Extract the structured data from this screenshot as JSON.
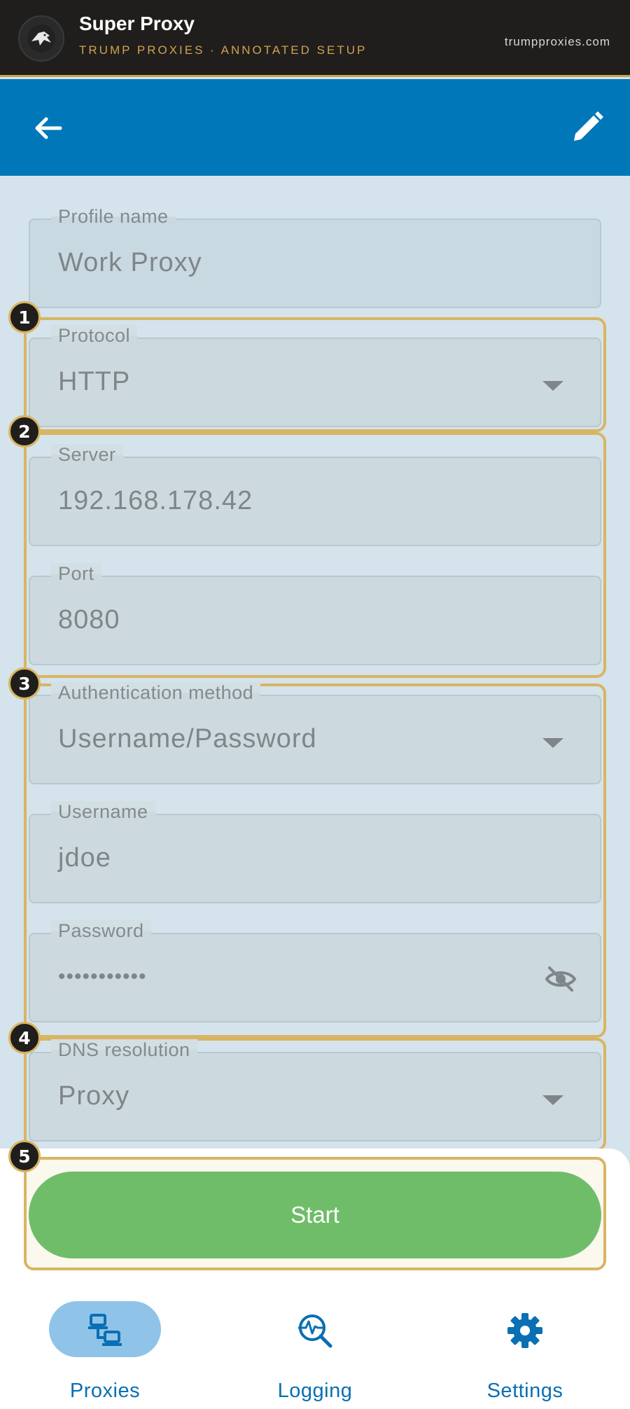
{
  "banner": {
    "app_name": "Super Proxy",
    "subtitle": "TRUMP PROXIES · ANNOTATED SETUP",
    "site": "trumpproxies.com"
  },
  "appbar": {
    "back_icon": "arrow-left-icon",
    "edit_icon": "pencil-icon"
  },
  "form": {
    "profile": {
      "label": "Profile name",
      "value": "Work Proxy"
    },
    "protocol": {
      "label": "Protocol",
      "value": "HTTP"
    },
    "server": {
      "label": "Server",
      "value": "192.168.178.42"
    },
    "port": {
      "label": "Port",
      "value": "8080"
    },
    "auth": {
      "label": "Authentication method",
      "value": "Username/Password"
    },
    "username": {
      "label": "Username",
      "value": "jdoe"
    },
    "password": {
      "label": "Password",
      "value": "•••••••••••"
    },
    "dns": {
      "label": "DNS resolution",
      "value": "Proxy"
    }
  },
  "annotations": [
    "1",
    "2",
    "3",
    "4",
    "5"
  ],
  "start_label": "Start",
  "nav": [
    {
      "label": "Proxies",
      "icon": "network-computers-icon",
      "active": true
    },
    {
      "label": "Logging",
      "icon": "magnify-activity-icon",
      "active": false
    },
    {
      "label": "Settings",
      "icon": "gear-icon",
      "active": false
    }
  ],
  "colors": {
    "appbar": "#0077b8",
    "annotation": "#d9b562",
    "start": "#6fbd68",
    "nav_accent": "#0a6fb4"
  }
}
